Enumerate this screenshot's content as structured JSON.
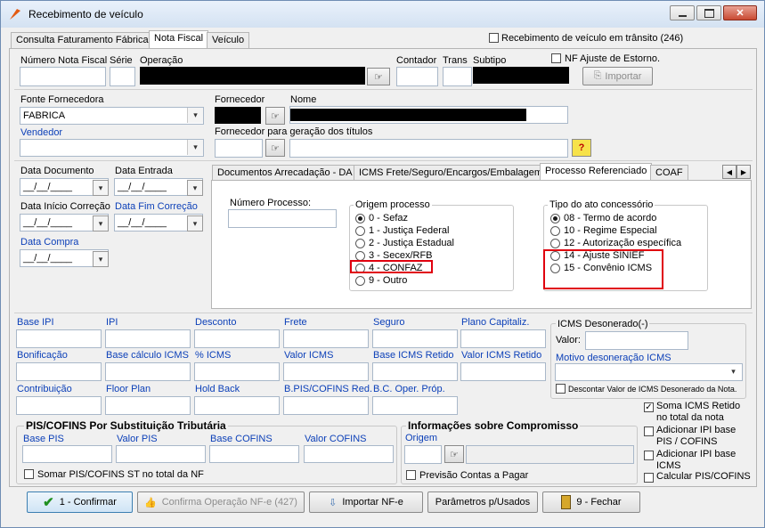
{
  "window": {
    "title": "Recebimento de veículo",
    "controls": [
      "minimize",
      "maximize",
      "close"
    ]
  },
  "main_tabs": [
    "Consulta Faturamento Fábrica",
    "Nota Fiscal",
    "Veículo"
  ],
  "transit": {
    "label": "Recebimento de veículo em trânsito (246)",
    "checked": false
  },
  "nota": {
    "numero_label": "Número Nota Fiscal",
    "serie_label": "Série",
    "operacao_label": "Operação",
    "contador_label": "Contador",
    "trans_label": "Trans",
    "subtipo_label": "Subtipo",
    "nf_ajuste_label": "NF Ajuste de Estorno.",
    "importar_label": "Importar"
  },
  "fornecedor": {
    "fonte_label": "Fonte Fornecedora",
    "fonte_value": "FABRICA",
    "vendedor_label": "Vendedor",
    "fornecedor_label": "Fornecedor",
    "nome_label": "Nome",
    "titulos_label": "Fornecedor para geração dos títulos",
    "help_label": "?"
  },
  "dates": {
    "documento_label": "Data Documento",
    "entrada_label": "Data Entrada",
    "inicio_label": "Data Início Correção",
    "fim_label": "Data Fim Correção",
    "compra_label": "Data Compra",
    "placeholder": "__/__/____"
  },
  "sub_tabs": [
    "Documentos Arrecadação - DA",
    "ICMS Frete/Seguro/Encargos/Embalagem",
    "Processo Referenciado",
    "COAF"
  ],
  "processo": {
    "numero_label": "Número Processo:",
    "origem_title": "Origem processo",
    "origem_options": [
      "0 - Sefaz",
      "1 - Justiça Federal",
      "2 - Justiça Estadual",
      "3 - Secex/RFB",
      "4 - CONFAZ",
      "9 - Outro"
    ],
    "origem_selected": 0,
    "tipo_title": "Tipo do ato concessório",
    "tipo_options": [
      "08 - Termo de acordo",
      "10 - Regime Especial",
      "12 - Autorização específica",
      "14 - Ajuste SINIEF",
      "15 - Convênio ICMS"
    ],
    "tipo_selected": 0
  },
  "totals": {
    "row1": [
      "Base IPI",
      "IPI",
      "Desconto",
      "Frete",
      "Seguro",
      "Plano Capitaliz."
    ],
    "row2": [
      "Bonificação",
      "Base cálculo ICMS",
      "% ICMS",
      "Valor ICMS",
      "Base ICMS Retido",
      "Valor ICMS Retido"
    ],
    "row3": [
      "Contribuição",
      "Floor Plan",
      "Hold Back",
      "B.PIS/COFINS Red.",
      "B.C. Oper. Próp."
    ]
  },
  "icms_desonerado": {
    "title": "ICMS Desonerado(-)",
    "valor_label": "Valor:",
    "motivo_label": "Motivo desoneração ICMS",
    "descontar_label": "Descontar Valor de ICMS Desonerado da Nota."
  },
  "right_checks": [
    {
      "label": "Soma ICMS Retido no total da nota",
      "checked": true
    },
    {
      "label": "Adicionar IPI base PIS / COFINS",
      "checked": false
    },
    {
      "label": "Adicionar IPI base ICMS",
      "checked": false
    },
    {
      "label": "Calcular PIS/COFINS",
      "checked": false
    }
  ],
  "pis_st": {
    "title": "PIS/COFINS Por Substituição Tributária",
    "base_pis": "Base PIS",
    "valor_pis": "Valor PIS",
    "base_cofins": "Base COFINS",
    "valor_cofins": "Valor COFINS",
    "somar_label": "Somar PIS/COFINS ST no total da NF"
  },
  "compromisso": {
    "title": "Informações sobre Compromisso",
    "origem_label": "Origem",
    "previsao_label": "Previsão Contas a Pagar"
  },
  "buttons": {
    "confirmar": "1 - Confirmar",
    "confirma_nfe": "Confirma Operação NF-e  (427)",
    "importar_nfe": "Importar  NF-e",
    "parametros": "Parâmetros p/Usados",
    "fechar": "9 - Fechar"
  },
  "colors": {
    "highlight": "#e0000e",
    "link_label": "#0b3fb8",
    "check_green": "#1f8f1f"
  }
}
